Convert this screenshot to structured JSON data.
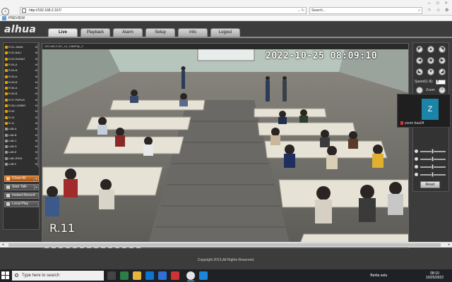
{
  "browser": {
    "url": "http://192.168.2.167/",
    "search_placeholder": "Search...",
    "tab_title": "PREVIEW"
  },
  "app": {
    "logo": "alhua",
    "tabs": [
      "Live",
      "Playback",
      "Alarm",
      "Setup",
      "Info",
      "Logout"
    ],
    "active_tab": "Live"
  },
  "channels": [
    {
      "name": "R.01-JAWA",
      "flag": "M"
    },
    {
      "name": "R.02-BALI",
      "flag": "M"
    },
    {
      "name": "R.03-SUMAT",
      "flag": "M"
    },
    {
      "name": "R.04-A",
      "flag": "M"
    },
    {
      "name": "R.04-B",
      "flag": "M"
    },
    {
      "name": "R.05-A",
      "flag": "M"
    },
    {
      "name": "R.05-B",
      "flag": "M"
    },
    {
      "name": "R.06-A",
      "flag": "M"
    },
    {
      "name": "R.06-B",
      "flag": "M"
    },
    {
      "name": "R.07-PAPUA",
      "flag": "M"
    },
    {
      "name": "R.08-LOMBO",
      "flag": "M"
    },
    {
      "name": "R.09",
      "flag": "M"
    },
    {
      "name": "R.10",
      "flag": "M"
    },
    {
      "name": "R.11",
      "flag": "M"
    },
    {
      "name": "LAB-A",
      "flag": "M"
    },
    {
      "name": "LAB-B",
      "flag": "M"
    },
    {
      "name": "LAB-C",
      "flag": "M"
    },
    {
      "name": "LAB-D",
      "flag": "M"
    },
    {
      "name": "LAB-E",
      "flag": "M"
    },
    {
      "name": "LAB-JRSN",
      "flag": "M"
    },
    {
      "name": "LAB-F",
      "flag": "M"
    }
  ],
  "controls": {
    "close_all": "Close All",
    "start_talk": "Start Talk",
    "instant_record": "Instant Record",
    "local_play": "Local Play"
  },
  "video": {
    "header": "192.168.2.167_14_1080P@_0",
    "timestamp": "2022-10-25 08:09:10",
    "room_label": "R.11"
  },
  "ptz": {
    "speed_label": "Speed(1-8):",
    "speed_value": "5",
    "zoom_label": "Zoom",
    "reset_label": "Reset"
  },
  "zoom_overlay": {
    "initial": "Z",
    "name": "zoom baa04"
  },
  "footer": {
    "copyright": "Copyright 2015,All Rights Reserved."
  },
  "taskbar": {
    "search_placeholder": "Type here to search",
    "weather": "Berita sela",
    "time": "08:10",
    "date": "10/25/2022"
  }
}
